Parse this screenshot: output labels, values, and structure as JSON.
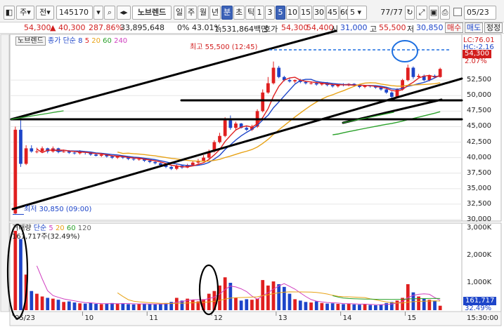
{
  "toolbar": {
    "market_label": "주",
    "mode_label": "전",
    "stock_code": "145170",
    "stock_name": "노브렌드",
    "period_tabs": [
      "일",
      "주",
      "월",
      "년",
      "분",
      "초",
      "틱"
    ],
    "active_period": "분",
    "interval_buttons": [
      "1",
      "3",
      "5",
      "10",
      "15",
      "30",
      "45",
      "60"
    ],
    "active_interval": "5",
    "interval_select": "5",
    "page_counter": "77/77",
    "date": "05/23"
  },
  "price_bar": {
    "price": "54,300",
    "change": "▲ 40,300",
    "change_pct": "287.86%",
    "volume": "33,895,648",
    "ratio": "0% 43.01%",
    "trade_amount": "1,531,864백만",
    "quote_label": "호가",
    "quote_price": "54,300",
    "quote_price2": "54,400",
    "open_label": "시",
    "open": "31,000",
    "high_label": "고",
    "high": "55,500",
    "low_label": "저",
    "low": "30,850",
    "buy_button": "매수",
    "sell_button": "매도",
    "extra_button": "정정"
  },
  "price_panel": {
    "legend_name": "노브렌드",
    "legend_ma": "종가 단순",
    "ma_periods": [
      "8",
      "5",
      "20",
      "60",
      "240"
    ],
    "ma_colors": [
      "#1d45c9",
      "#e01f1f",
      "#e8a317",
      "#2aa12a",
      "#d040c0"
    ],
    "high_annotation": "최고 55,500 (12:45)",
    "low_annotation": "최저 30,850 (09:00)",
    "lc_label": "LC:76.01",
    "hc_label": "HC:-2.16",
    "current_price_tag": "54,300",
    "current_pct_tag": "2.07%",
    "y_axis_ticks": [
      "52,500",
      "50,000",
      "47,500",
      "45,000",
      "42,500",
      "40,000",
      "37,500",
      "35,000",
      "32,500",
      "30,000"
    ]
  },
  "volume_panel": {
    "legend_name": "거래량",
    "legend_ma": "단순",
    "ma_periods": [
      "5",
      "20",
      "60",
      "120"
    ],
    "ma_colors": [
      "#d040c0",
      "#e8a317",
      "#2aa12a",
      "#666666"
    ],
    "volume_annotation": "161,717주(32.49%)",
    "current_volume_tag": "161,717",
    "current_pct_tag": "32.49%",
    "y_axis_ticks": [
      "3,000K",
      "2,000K",
      "1,000K"
    ]
  },
  "time_axis": {
    "ticks": [
      "05/23",
      "10",
      "11",
      "12",
      "13",
      "14",
      "15"
    ],
    "end_label": "15:30:00"
  },
  "chart_data": {
    "type": "bar",
    "title": "",
    "xlabel": "",
    "ylabel": "",
    "ylim": [
      30000,
      57500
    ],
    "volume_ylim": [
      0,
      3000000
    ],
    "candles_open": [
      31000,
      44500,
      39000,
      41500,
      41000,
      41000,
      41500,
      41000,
      41500,
      41000,
      41000,
      40800,
      40700,
      41000,
      40800,
      40500,
      40300,
      40500,
      40200,
      40000,
      40200,
      40000,
      39800,
      39700,
      39800,
      39500,
      39300,
      39100,
      38800,
      38500,
      38200,
      38700,
      38400,
      38800,
      39200,
      39500,
      40000,
      41000,
      42500,
      43500,
      46000,
      44800,
      45500,
      44800,
      44500,
      45000,
      47500,
      50500,
      52000,
      54500,
      53000,
      52500,
      52300,
      52500,
      52200,
      52000,
      52000,
      51800,
      52000,
      51700,
      51500,
      51800,
      51700,
      51900,
      51600,
      51400,
      51600,
      51500,
      51300,
      51000,
      50500,
      49800,
      51000,
      52500,
      54500,
      53000,
      53200,
      52500,
      53200,
      53000
    ],
    "candles_close": [
      44500,
      39000,
      41500,
      41000,
      41000,
      41500,
      41000,
      41500,
      41000,
      41000,
      40800,
      40700,
      41000,
      40800,
      40500,
      40300,
      40500,
      40200,
      40000,
      40200,
      40000,
      39800,
      39700,
      39800,
      39500,
      39300,
      39100,
      38800,
      38500,
      38200,
      38700,
      38400,
      38800,
      39200,
      39500,
      40000,
      41000,
      42500,
      43500,
      46000,
      44800,
      45500,
      44800,
      44500,
      45000,
      47500,
      50500,
      52000,
      54500,
      53000,
      52500,
      52300,
      52500,
      52200,
      52000,
      52000,
      51800,
      52000,
      51700,
      51500,
      51800,
      51700,
      51900,
      51600,
      51400,
      51600,
      51500,
      51300,
      51000,
      50500,
      49800,
      51000,
      52500,
      54500,
      53000,
      53200,
      52500,
      53200,
      53000,
      54300
    ],
    "candles_high": [
      45000,
      46000,
      42000,
      42000,
      41600,
      41800,
      41600,
      41800,
      41600,
      41300,
      41200,
      41000,
      41200,
      41000,
      40900,
      40700,
      40700,
      40600,
      40400,
      40300,
      40300,
      40200,
      40000,
      40000,
      39900,
      39600,
      39500,
      39200,
      38900,
      38700,
      38900,
      38800,
      39000,
      39400,
      39800,
      40400,
      41300,
      42800,
      44000,
      46500,
      46800,
      45800,
      45600,
      45100,
      45300,
      47800,
      51000,
      53000,
      55500,
      54800,
      53200,
      52800,
      52600,
      52700,
      52400,
      52300,
      52200,
      52100,
      52200,
      52000,
      51900,
      52000,
      52000,
      52000,
      51800,
      51700,
      51700,
      51600,
      51400,
      51200,
      50700,
      51200,
      52700,
      55000,
      54700,
      53500,
      53400,
      53400,
      53400,
      54500
    ],
    "candles_low": [
      30850,
      38500,
      38800,
      40800,
      40700,
      40800,
      40700,
      40800,
      40700,
      40800,
      40600,
      40500,
      40500,
      40500,
      40300,
      40200,
      40100,
      40000,
      39800,
      39800,
      39800,
      39600,
      39500,
      39500,
      39300,
      39100,
      38900,
      38600,
      38300,
      38000,
      38000,
      38200,
      38300,
      38700,
      39000,
      39400,
      39800,
      40800,
      42300,
      43300,
      44500,
      44500,
      44700,
      44300,
      44300,
      44800,
      47300,
      50300,
      51800,
      52800,
      52300,
      52100,
      52000,
      52000,
      51800,
      51800,
      51600,
      51600,
      51500,
      51300,
      51300,
      51500,
      51500,
      51400,
      51200,
      51200,
      51300,
      51100,
      50800,
      50300,
      49500,
      49600,
      50800,
      52300,
      52700,
      52800,
      52300,
      52300,
      52800,
      52900
    ],
    "volume": [
      2900000,
      2600000,
      1300000,
      700000,
      600000,
      500000,
      450000,
      420000,
      380000,
      300000,
      320000,
      280000,
      250000,
      240000,
      260000,
      230000,
      220000,
      240000,
      260000,
      230000,
      250000,
      220000,
      210000,
      230000,
      240000,
      220000,
      210000,
      230000,
      260000,
      300000,
      450000,
      350000,
      420000,
      380000,
      320000,
      400000,
      600000,
      700000,
      900000,
      1200000,
      1000000,
      450000,
      350000,
      400000,
      380000,
      420000,
      1100000,
      900000,
      1050000,
      950000,
      850000,
      600000,
      400000,
      350000,
      300000,
      280000,
      320000,
      260000,
      240000,
      250000,
      230000,
      220000,
      240000,
      210000,
      200000,
      230000,
      190000,
      180000,
      200000,
      260000,
      300000,
      350000,
      450000,
      950000,
      650000,
      500000,
      420000,
      380000,
      350000,
      161717
    ]
  }
}
